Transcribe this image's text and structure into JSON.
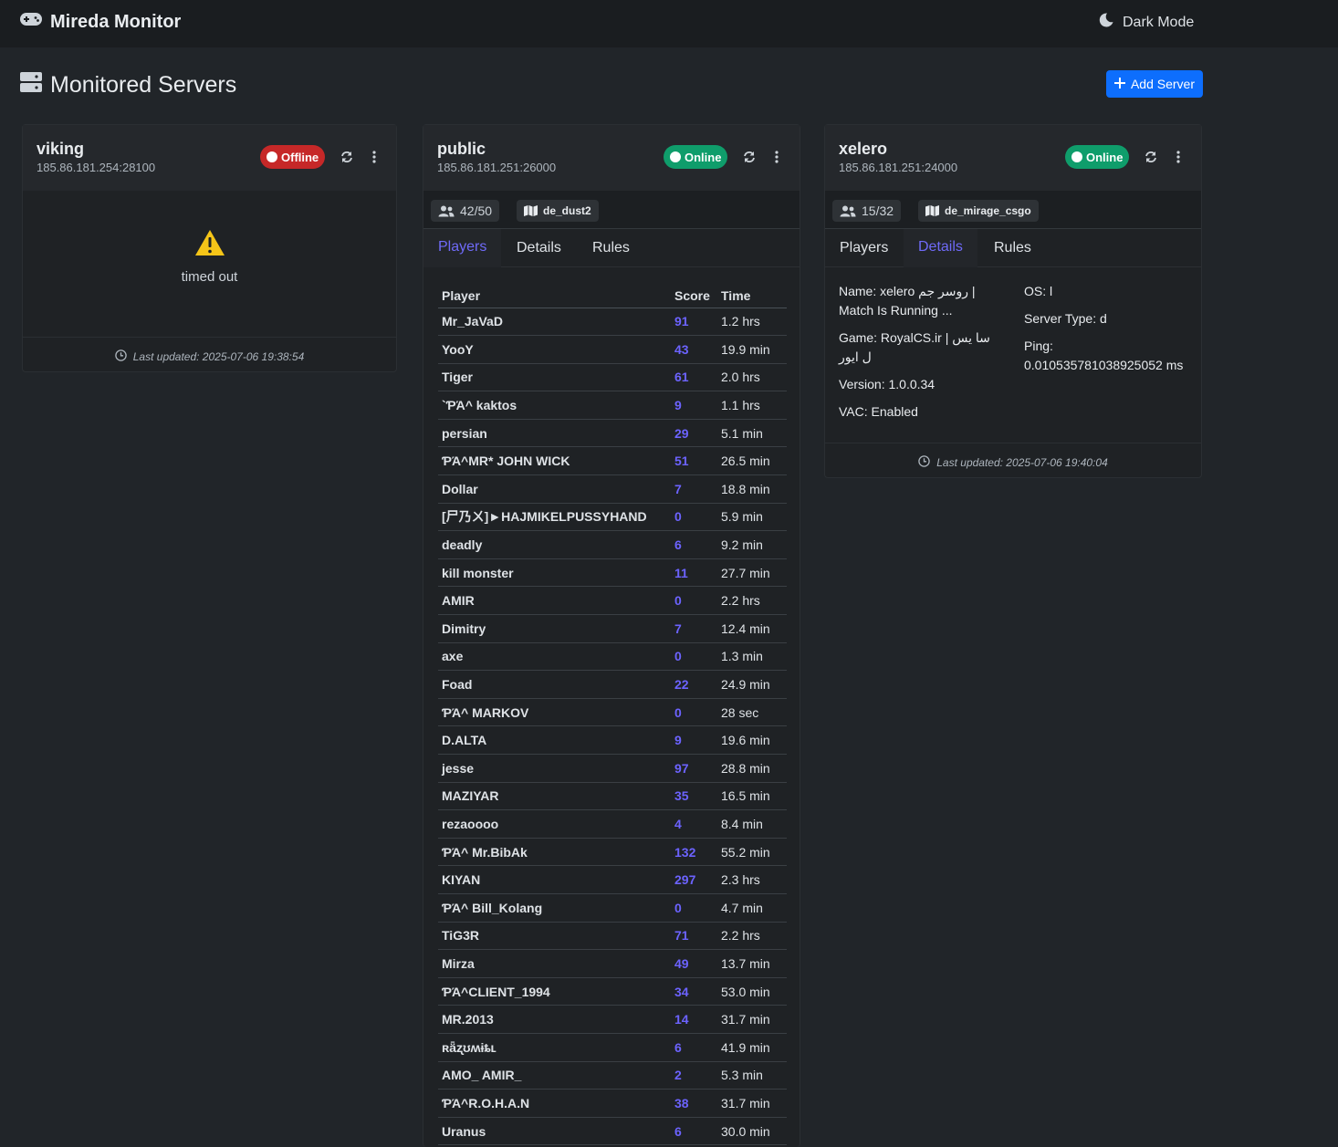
{
  "app": {
    "title": "Mireda Monitor",
    "dark_mode_label": "Dark Mode",
    "section_title": "Monitored Servers",
    "add_server_label": "Add Server"
  },
  "colors": {
    "background": "#212529",
    "accent": "#0d6efd",
    "online": "#0f9d6b",
    "offline": "#c62828",
    "score": "#6c63ff",
    "warning": "#f5c518"
  },
  "servers": {
    "viking": {
      "name": "viking",
      "address": "185.86.181.254:28100",
      "status": "Offline",
      "error": "timed out",
      "last_updated": "Last updated: 2025-07-06 19:38:54"
    },
    "public": {
      "name": "public",
      "address": "185.86.181.251:26000",
      "status": "Online",
      "players_count": "42/50",
      "map": "de_dust2",
      "tabs": [
        "Players",
        "Details",
        "Rules"
      ],
      "active_tab": "Players",
      "columns": [
        "Player",
        "Score",
        "Time"
      ],
      "players": [
        [
          "Mr_JaVaD",
          "91",
          "1.2 hrs"
        ],
        [
          "YooY",
          "43",
          "19.9 min"
        ],
        [
          "Tiger",
          "61",
          "2.0 hrs"
        ],
        [
          "`ƤΆ^ kaktos",
          "9",
          "1.1 hrs"
        ],
        [
          "persian",
          "29",
          "5.1 min"
        ],
        [
          "ƤΆ^MR* JOHN WICK",
          "51",
          "26.5 min"
        ],
        [
          "Dollar",
          "7",
          "18.8 min"
        ],
        [
          "[尸乃ㄨ]►HAJMIKELPUSSYHAND",
          "0",
          "5.9 min"
        ],
        [
          "deadly",
          "6",
          "9.2 min"
        ],
        [
          "kill monster",
          "11",
          "27.7 min"
        ],
        [
          "AMIR",
          "0",
          "2.2 hrs"
        ],
        [
          "Dimitry",
          "7",
          "12.4 min"
        ],
        [
          "axe",
          "0",
          "1.3 min"
        ],
        [
          "Foad",
          "22",
          "24.9 min"
        ],
        [
          "ƤΆ^ MARKOV",
          "0",
          "28 sec"
        ],
        [
          "D.ALTA",
          "9",
          "19.6 min"
        ],
        [
          "jesse",
          "97",
          "28.8 min"
        ],
        [
          "MAZIYAR",
          "35",
          "16.5 min"
        ],
        [
          "rezaoooo",
          "4",
          "8.4 min"
        ],
        [
          "ƤΆ^ Mr.BibAk",
          "132",
          "55.2 min"
        ],
        [
          "KIYAN",
          "297",
          "2.3 hrs"
        ],
        [
          "ƤΆ^ Bill_Kolang",
          "0",
          "4.7 min"
        ],
        [
          "TiG3R",
          "71",
          "2.2 hrs"
        ],
        [
          "Mirza",
          "49",
          "13.7 min"
        ],
        [
          "ƤΆ^CLIENT_1994",
          "34",
          "53.0 min"
        ],
        [
          "MR.2013",
          "14",
          "31.7 min"
        ],
        [
          "ʀǟʐʊʍɨȶʟ",
          "6",
          "41.9 min"
        ],
        [
          "AMO_ AMIR_",
          "2",
          "5.3 min"
        ],
        [
          "ƤΆ^R.O.H.A.N",
          "38",
          "31.7 min"
        ],
        [
          "Uranus",
          "6",
          "30.0 min"
        ]
      ]
    },
    "xelero": {
      "name": "xelero",
      "address": "185.86.181.251:24000",
      "status": "Online",
      "players_count": "15/32",
      "map": "de_mirage_csgo",
      "tabs": [
        "Players",
        "Details",
        "Rules"
      ],
      "active_tab": "Details",
      "details": {
        "name_label": "Name:",
        "name_value": "xelero روسر جم | Match Is Running ...",
        "game_label": "Game:",
        "game_value": "RoyalCS.ir | سا یس ل ایور",
        "version_label": "Version:",
        "version_value": "1.0.0.34",
        "vac_label": "VAC:",
        "vac_value": "Enabled",
        "os_label": "OS:",
        "os_value": "l",
        "type_label": "Server Type:",
        "type_value": "d",
        "ping_label": "Ping:",
        "ping_value": "0.010535781038925052 ms"
      },
      "last_updated": "Last updated: 2025-07-06 19:40:04"
    }
  }
}
